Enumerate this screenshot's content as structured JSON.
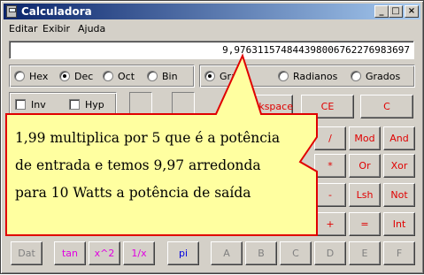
{
  "window": {
    "title": "Calculadora",
    "controls": {
      "minimize": "_",
      "maximize": "□",
      "close": "×"
    }
  },
  "menu": {
    "items": [
      "Editar",
      "Exibir",
      "Ajuda"
    ]
  },
  "display": {
    "value": "9,976311574844398006762276983697"
  },
  "base_radios": [
    {
      "label": "Hex",
      "selected": false
    },
    {
      "label": "Dec",
      "selected": true
    },
    {
      "label": "Oct",
      "selected": false
    },
    {
      "label": "Bin",
      "selected": false
    }
  ],
  "angle_radios": [
    {
      "label": "Graus",
      "selected": true
    },
    {
      "label": "Radianos",
      "selected": false
    },
    {
      "label": "Grados",
      "selected": false
    }
  ],
  "checkboxes": [
    {
      "label": "Inv",
      "checked": false
    },
    {
      "label": "Hyp",
      "checked": false
    }
  ],
  "edit_buttons": {
    "backspace": "Backspace",
    "ce": "CE",
    "c": "C"
  },
  "op_buttons": [
    [
      "/",
      "Mod",
      "And"
    ],
    [
      "*",
      "Or",
      "Xor"
    ],
    [
      "-",
      "Lsh",
      "Not"
    ],
    [
      "+",
      "=",
      "Int"
    ]
  ],
  "bottom_row": [
    "Dat",
    "tan",
    "x^2",
    "1/x",
    "pi",
    "A",
    "B",
    "C",
    "D",
    "E",
    "F"
  ],
  "callout": {
    "lines": [
      "1,99 multiplica por 5 que é a potência",
      "de entrada e temos 9,97 arredonda",
      "para 10 Watts a potência de saída"
    ],
    "fill": "#ffffa0",
    "stroke": "#e00000"
  },
  "colors": {
    "title_start": "#0a246a",
    "title_end": "#a6caf0",
    "face": "#d4d0c8",
    "red_label": "#e00000",
    "blue_label": "#0000e0",
    "magenta_label": "#e000e0"
  }
}
